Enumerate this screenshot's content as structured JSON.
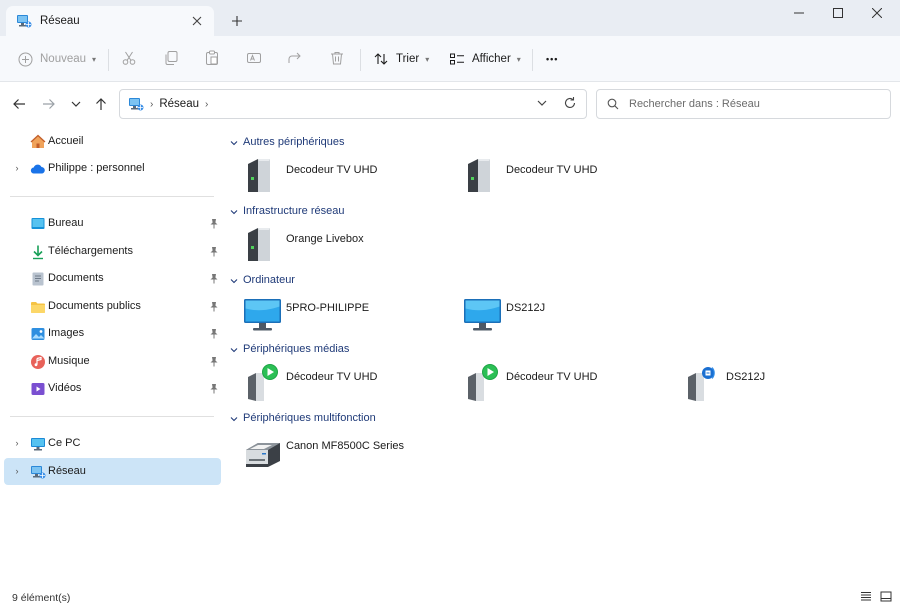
{
  "window": {
    "tab_title": "Réseau",
    "tab_icon": "network-icon",
    "controls": [
      "minimize-icon",
      "maximize-icon",
      "close-icon"
    ]
  },
  "toolbar": {
    "new_label": "Nouveau",
    "sort_label": "Trier",
    "view_label": "Afficher",
    "more_label": "•••",
    "disabled_actions": [
      "cut-icon",
      "copy-icon",
      "paste-icon",
      "rename-icon",
      "share-icon",
      "delete-icon"
    ]
  },
  "address": {
    "crumbs": [
      "Réseau"
    ],
    "search_placeholder": "Rechercher dans : Réseau"
  },
  "sidebar": {
    "home": {
      "label": "Accueil",
      "icon": "home-icon"
    },
    "cloud": {
      "label": "Philippe : personnel",
      "icon": "onedrive-icon"
    },
    "quick_access": [
      {
        "label": "Bureau",
        "icon": "desktop-folder-icon"
      },
      {
        "label": "Téléchargements",
        "icon": "downloads-icon"
      },
      {
        "label": "Documents",
        "icon": "documents-icon"
      },
      {
        "label": "Documents publics",
        "icon": "folder-icon"
      },
      {
        "label": "Images",
        "icon": "pictures-icon"
      },
      {
        "label": "Musique",
        "icon": "music-icon"
      },
      {
        "label": "Vidéos",
        "icon": "videos-icon"
      }
    ],
    "this_pc": {
      "label": "Ce PC",
      "icon": "pc-icon"
    },
    "network": {
      "label": "Réseau",
      "icon": "network-icon",
      "selected": true
    }
  },
  "groups": [
    {
      "name": "Autres périphériques",
      "items": [
        {
          "label": "Decodeur TV UHD",
          "icon": "device-tower-icon"
        },
        {
          "label": "Decodeur TV UHD",
          "icon": "device-tower-icon"
        }
      ]
    },
    {
      "name": "Infrastructure réseau",
      "items": [
        {
          "label": "Orange Livebox",
          "icon": "device-tower-icon"
        }
      ]
    },
    {
      "name": "Ordinateur",
      "items": [
        {
          "label": "5PRO-PHILIPPE",
          "icon": "monitor-icon"
        },
        {
          "label": "DS212J",
          "icon": "monitor-icon"
        }
      ]
    },
    {
      "name": "Périphériques médias",
      "items": [
        {
          "label": "Décodeur TV UHD",
          "icon": "media-device-icon"
        },
        {
          "label": "Décodeur TV UHD",
          "icon": "media-device-icon"
        },
        {
          "label": "DS212J",
          "icon": "media-server-icon"
        }
      ]
    },
    {
      "name": "Périphériques multifonction",
      "items": [
        {
          "label": "Canon MF8500C Series",
          "icon": "printer-icon"
        }
      ]
    }
  ],
  "status": {
    "count_text": "9 élément(s)"
  },
  "colors": {
    "accent": "#0067c0",
    "selection": "#cce4f7",
    "group_header": "#1f3a78"
  }
}
